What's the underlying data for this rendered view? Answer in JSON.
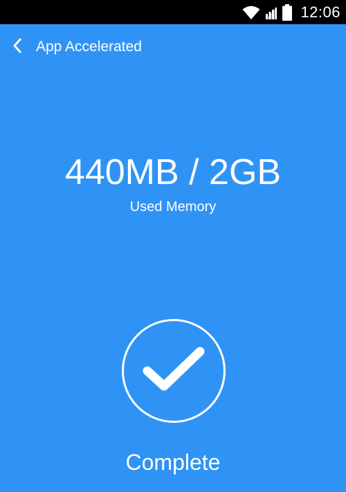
{
  "status_bar": {
    "time": "12:06",
    "icons": [
      "wifi-icon",
      "signal-icon",
      "battery-icon"
    ]
  },
  "header": {
    "back_icon": "chevron-left-icon",
    "title": "App Accelerated"
  },
  "memory": {
    "value": "440MB / 2GB",
    "label": "Used Memory"
  },
  "result": {
    "icon": "check-icon",
    "label": "Complete"
  },
  "colors": {
    "background": "#2f93f5",
    "status_bar": "#000000",
    "foreground": "#ffffff"
  }
}
